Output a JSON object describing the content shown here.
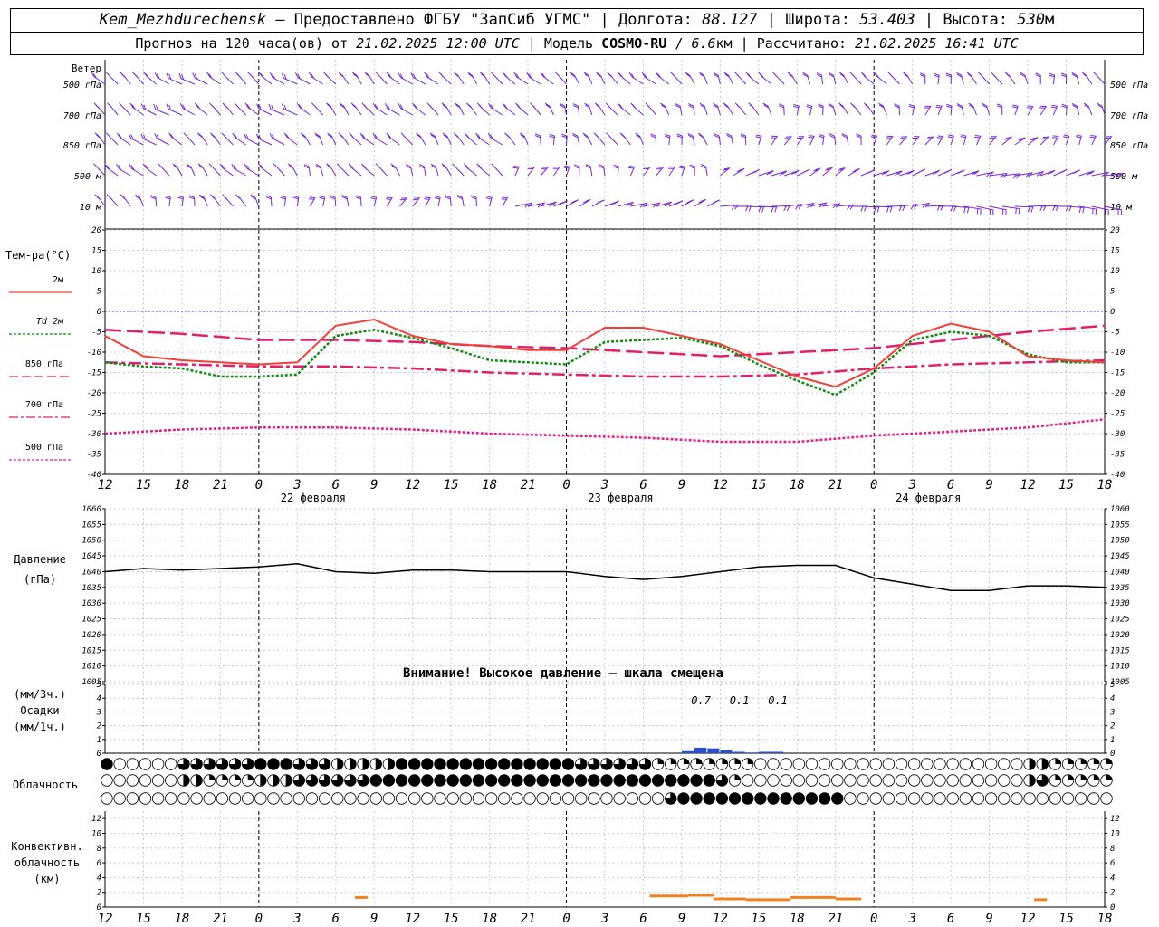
{
  "header": {
    "station": "Kem_Mezhdurechensk",
    "provided_by": "– Предоставлено ФГБУ \"ЗапСиб УГМС\"",
    "lon_label": "Долгота:",
    "lon": "88.127",
    "lat_label": "Широта:",
    "lat": "53.403",
    "alt_label": "Высота:",
    "alt": "530",
    "alt_unit": "м",
    "forecast_prefix": "Прогноз на 120 часа(ов) от",
    "forecast_from": "21.02.2025 12:00 UTC",
    "model_label": "Модель",
    "model": "COSMO-RU",
    "resolution": "6.6",
    "resolution_unit": "км",
    "computed_label": "Рассчитано:",
    "computed": "21.02.2025 16:41 UTC"
  },
  "colors": {
    "wind": "#7a28d0",
    "t2m": "#f0403a",
    "td2m": "#138a13",
    "t850": "#e0206e",
    "t700": "#e0206e",
    "t500": "#e0208c",
    "pressure": "#000000",
    "precip": "#2a50d0",
    "convective": "#f08020",
    "zero_line": "#2848d8"
  },
  "chart_data": {
    "type": "line",
    "time_axis": {
      "start_hour": 12,
      "step_hours": 3,
      "ticks": [
        "12",
        "15",
        "18",
        "21",
        "0",
        "3",
        "6",
        "9",
        "12",
        "15",
        "18",
        "21",
        "0",
        "3",
        "6",
        "9",
        "12",
        "15",
        "18",
        "21",
        "0",
        "3",
        "6",
        "9",
        "12",
        "15",
        "18"
      ],
      "day_labels": [
        {
          "label": "22 февраля",
          "at_hour": 12
        },
        {
          "label": "23 февраля",
          "at_hour": 36
        },
        {
          "label": "24 февраля",
          "at_hour": 60
        }
      ],
      "midnights_hours": [
        12,
        36,
        60
      ]
    },
    "wind": {
      "title": "Ветер",
      "levels": [
        "500 гПа",
        "700 гПа",
        "850 гПа",
        "500 м",
        "10 м"
      ]
    },
    "temperature": {
      "title": "Тем-ра(°С)",
      "ylim": [
        -40,
        20
      ],
      "ticks": [
        20,
        15,
        10,
        5,
        0,
        -5,
        -10,
        -15,
        -20,
        -25,
        -30,
        -35,
        -40
      ],
      "legend": [
        {
          "label": "2м",
          "key": "t2m"
        },
        {
          "label": "Td 2м",
          "key": "td2m"
        },
        {
          "label": "850 гПа",
          "key": "t850"
        },
        {
          "label": "700 гПа",
          "key": "t700"
        },
        {
          "label": "500 гПа",
          "key": "t500"
        }
      ],
      "series": {
        "t2m": {
          "hours": [
            0,
            3,
            6,
            9,
            12,
            15,
            18,
            21,
            24,
            27,
            30,
            33,
            36,
            39,
            42,
            45,
            48,
            51,
            54,
            57,
            60,
            63,
            66,
            69,
            72,
            75,
            78
          ],
          "values": [
            -6,
            -11,
            -12,
            -12.5,
            -13,
            -12.5,
            -3.5,
            -2,
            -6,
            -8,
            -8.5,
            -9.5,
            -9.5,
            -4,
            -4,
            -6,
            -8,
            -12,
            -16,
            -18.5,
            -14,
            -6,
            -3,
            -5,
            -11,
            -12,
            -12.5
          ]
        },
        "td2m": {
          "hours": [
            0,
            3,
            6,
            9,
            12,
            15,
            18,
            21,
            24,
            27,
            30,
            33,
            36,
            39,
            42,
            45,
            48,
            51,
            54,
            57,
            60,
            63,
            66,
            69,
            72,
            75,
            78
          ],
          "values": [
            -12.5,
            -13.5,
            -14,
            -16,
            -16,
            -15.5,
            -6,
            -4.5,
            -6.5,
            -9,
            -12,
            -12.5,
            -13,
            -7.5,
            -7,
            -6.5,
            -8.5,
            -13,
            -17,
            -20.5,
            -15,
            -7,
            -5,
            -6,
            -10.5,
            -12.5,
            -12.5
          ]
        },
        "t850": {
          "hours": [
            0,
            6,
            12,
            18,
            24,
            30,
            36,
            42,
            48,
            54,
            60,
            66,
            72,
            78
          ],
          "values": [
            -4.5,
            -5.5,
            -7,
            -7,
            -7.5,
            -8.5,
            -9,
            -10,
            -11,
            -10,
            -9,
            -7,
            -5,
            -3.5
          ]
        },
        "t700": {
          "hours": [
            0,
            6,
            12,
            18,
            24,
            30,
            36,
            42,
            48,
            54,
            60,
            66,
            72,
            78
          ],
          "values": [
            -12.5,
            -13,
            -13.5,
            -13.5,
            -14,
            -15,
            -15.5,
            -16,
            -16,
            -15.5,
            -14,
            -13,
            -12.5,
            -12
          ]
        },
        "t500": {
          "hours": [
            0,
            6,
            12,
            18,
            24,
            30,
            36,
            42,
            48,
            54,
            60,
            66,
            72,
            78
          ],
          "values": [
            -30,
            -29,
            -28.5,
            -28.5,
            -29,
            -30,
            -30.5,
            -31,
            -32,
            -32,
            -30.5,
            -29.5,
            -28.5,
            -26.5
          ]
        }
      }
    },
    "pressure": {
      "title": "Давление",
      "unit": "(гПа)",
      "ylim": [
        1005,
        1060
      ],
      "ticks": [
        1060,
        1055,
        1050,
        1045,
        1040,
        1035,
        1030,
        1025,
        1020,
        1015,
        1010,
        1005
      ],
      "note": "Внимание! Высокое давление – шкала смещена",
      "hours": [
        0,
        3,
        6,
        9,
        12,
        15,
        18,
        21,
        24,
        27,
        30,
        33,
        36,
        39,
        42,
        45,
        48,
        51,
        54,
        57,
        60,
        63,
        66,
        69,
        72,
        75,
        78
      ],
      "values": [
        1040,
        1041,
        1040.5,
        1041,
        1041.5,
        1042.5,
        1040,
        1039.5,
        1040.5,
        1040.5,
        1040,
        1040,
        1040,
        1038.5,
        1037.5,
        1038.5,
        1040,
        1041.5,
        1042,
        1042,
        1038,
        1036,
        1034,
        1034,
        1035.5,
        1035.5,
        1035
      ]
    },
    "precip": {
      "title": "Осадки",
      "unit_top": "(мм/3ч.)",
      "unit_bottom": "(мм/1ч.)",
      "ylim": [
        0,
        5
      ],
      "ticks": [
        5,
        4,
        3,
        2,
        1,
        0
      ],
      "labels": [
        {
          "at_hour": 46.5,
          "value": "0.7"
        },
        {
          "at_hour": 49.5,
          "value": "0.1"
        },
        {
          "at_hour": 52.5,
          "value": "0.1"
        }
      ],
      "bars": [
        {
          "at_hour": 45,
          "value": 0.15
        },
        {
          "at_hour": 46,
          "value": 0.4
        },
        {
          "at_hour": 47,
          "value": 0.35
        },
        {
          "at_hour": 48,
          "value": 0.2
        },
        {
          "at_hour": 49,
          "value": 0.1
        },
        {
          "at_hour": 50,
          "value": 0.05
        },
        {
          "at_hour": 51,
          "value": 0.1
        },
        {
          "at_hour": 52,
          "value": 0.1
        }
      ]
    },
    "cloud": {
      "title": "Облачность",
      "rows": [
        {
          "level": "upper",
          "segments": [
            [
              0,
              0,
              5
            ],
            [
              6,
              11,
              3
            ],
            [
              12,
              14,
              5
            ],
            [
              15,
              17,
              3
            ],
            [
              18,
              22,
              2
            ],
            [
              23,
              36,
              5
            ],
            [
              37,
              42,
              3
            ],
            [
              43,
              50,
              1
            ],
            [
              51,
              71,
              0
            ],
            [
              72,
              73,
              2
            ],
            [
              74,
              78,
              1
            ]
          ]
        },
        {
          "level": "middle",
          "segments": [
            [
              0,
              5,
              0
            ],
            [
              6,
              7,
              2
            ],
            [
              8,
              11,
              1
            ],
            [
              12,
              14,
              2
            ],
            [
              15,
              20,
              3
            ],
            [
              21,
              47,
              5
            ],
            [
              48,
              48,
              3
            ],
            [
              49,
              49,
              1
            ],
            [
              50,
              71,
              0
            ],
            [
              72,
              72,
              2
            ],
            [
              73,
              73,
              3
            ],
            [
              74,
              78,
              1
            ]
          ]
        },
        {
          "level": "lower",
          "segments": [
            [
              0,
              43,
              0
            ],
            [
              44,
              44,
              3
            ],
            [
              45,
              57,
              5
            ],
            [
              58,
              78,
              0
            ]
          ]
        }
      ]
    },
    "convective": {
      "title_lines": [
        "Конвективн.",
        "облачность",
        "(км)"
      ],
      "ylim": [
        0,
        13
      ],
      "ticks": [
        12,
        10,
        8,
        6,
        4,
        2,
        0
      ],
      "segments": [
        {
          "from_hour": 19.5,
          "to_hour": 20.5,
          "value": 1.3
        },
        {
          "from_hour": 42.5,
          "to_hour": 45.5,
          "value": 1.5
        },
        {
          "from_hour": 45.5,
          "to_hour": 47.5,
          "value": 1.6
        },
        {
          "from_hour": 47.5,
          "to_hour": 50,
          "value": 1.1
        },
        {
          "from_hour": 50,
          "to_hour": 53.5,
          "value": 1.0
        },
        {
          "from_hour": 53.5,
          "to_hour": 57,
          "value": 1.3
        },
        {
          "from_hour": 57,
          "to_hour": 59,
          "value": 1.1
        },
        {
          "from_hour": 72.5,
          "to_hour": 73.5,
          "value": 1.0
        }
      ]
    }
  }
}
